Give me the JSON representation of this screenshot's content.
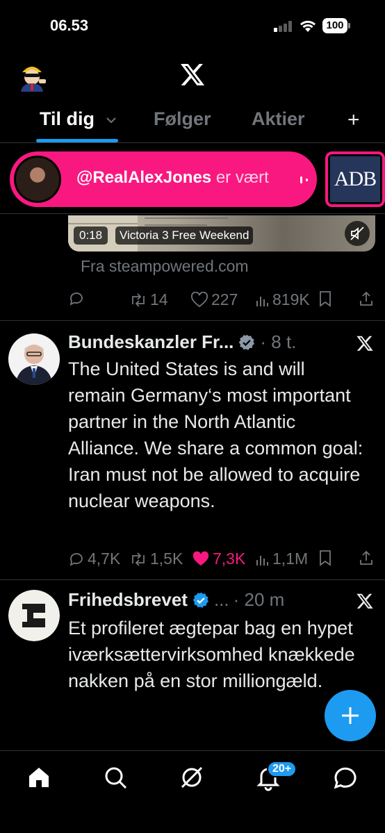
{
  "status_bar": {
    "time": "06.53",
    "battery": "100"
  },
  "header": {
    "logo_icon": "x-logo-icon",
    "avatar_icon": "profile-avatar-icon"
  },
  "tabs": [
    {
      "label": "Til dig",
      "active": true
    },
    {
      "label": "Følger",
      "active": false
    },
    {
      "label": "Aktier",
      "active": false
    }
  ],
  "spaces": {
    "host": "@RealAlexJones",
    "status": " er vært",
    "second_card_logo": "ADB",
    "accent_color": "#f91880"
  },
  "previous_post": {
    "video_time": "0:18",
    "video_title": "Victoria 3 Free Weekend",
    "link_source": "Fra steampowered.com",
    "reposts": "14",
    "likes": "227",
    "views": "819K"
  },
  "posts": [
    {
      "author": "Bundeskanzler Fr...",
      "time": "· 8 t.",
      "text": "The United States is and will remain Germany‘s most important partner in the North Atlantic Alliance. We share a common goal: Iran must not be allowed to acquire nuclear weapons.",
      "replies": "4,7K",
      "reposts": "1,5K",
      "likes": "7,3K",
      "views": "1,1M",
      "liked": true
    },
    {
      "author": "Frihedsbrevet",
      "ellipsis": "...",
      "time": "· 20 m",
      "text": "Et profileret ægtepar bag en hypet iværksættervirksomhed knækkede nakken på en stor milliongæld."
    }
  ],
  "bottom_nav": {
    "items": [
      "home-icon",
      "search-icon",
      "grok-icon",
      "notifications-icon",
      "messages-icon"
    ],
    "notification_badge": "20+"
  },
  "colors": {
    "accent_blue": "#1d9bf0",
    "like_pink": "#f91880",
    "muted": "#71767b"
  }
}
